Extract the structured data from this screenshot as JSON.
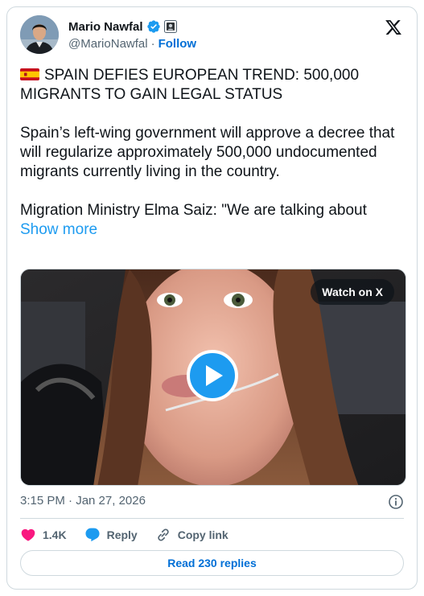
{
  "author": {
    "name": "Mario Nawfal",
    "handle": "@MarioNawfal",
    "separator": "·",
    "follow_label": "Follow",
    "verified_icon": "verified-badge-icon",
    "affiliation_icon": "affiliate-badge-icon"
  },
  "brand": {
    "logo_icon": "x-logo-icon"
  },
  "tweet": {
    "headline_flag": "spain-flag-icon",
    "headline": "SPAIN DEFIES EUROPEAN TREND: 500,000 MIGRANTS TO GAIN LEGAL STATUS",
    "paragraph": "Spain’s left-wing government will approve a decree that will regularize approximately 500,000 undocumented migrants currently living in the country.",
    "quote_start": "Migration Ministry Elma Saiz: \"We are talking about",
    "show_more": "Show more"
  },
  "media": {
    "watch_label": "Watch on X",
    "play_icon": "play-icon"
  },
  "meta": {
    "timestamp": "3:15 PM · Jan 27, 2026",
    "info_icon": "info-icon"
  },
  "actions": {
    "likes": "1.4K",
    "reply_label": "Reply",
    "copy_link_label": "Copy link"
  },
  "replies_button": "Read 230 replies",
  "colors": {
    "link": "#1d9bf0",
    "follow": "#006fd6",
    "like": "#f91880",
    "secondary_text": "#536471",
    "border": "#cfd9de"
  }
}
